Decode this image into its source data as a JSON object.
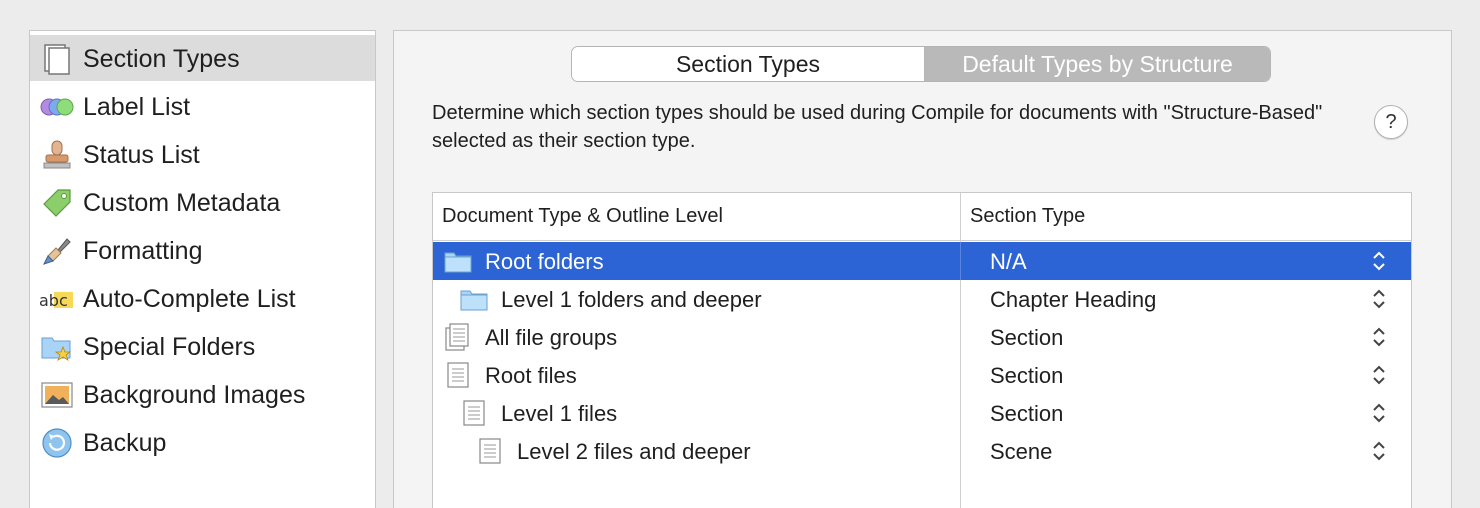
{
  "sidebar": {
    "items": [
      {
        "label": "Section Types",
        "icon": "pages-icon",
        "selected": true
      },
      {
        "label": "Label List",
        "icon": "label-circles-icon"
      },
      {
        "label": "Status List",
        "icon": "stamp-icon"
      },
      {
        "label": "Custom Metadata",
        "icon": "tag-icon"
      },
      {
        "label": "Formatting",
        "icon": "paintbrush-icon"
      },
      {
        "label": "Auto-Complete List",
        "icon": "abc-icon",
        "icon_text": "abc"
      },
      {
        "label": "Special Folders",
        "icon": "star-folder-icon"
      },
      {
        "label": "Background Images",
        "icon": "picture-icon"
      },
      {
        "label": "Backup",
        "icon": "backup-icon"
      }
    ]
  },
  "segmented": {
    "tab1": "Section Types",
    "tab2": "Default Types by Structure",
    "active": "tab2"
  },
  "description": "Determine which section types should be used during Compile for documents with \"Structure-Based\" selected as their section type.",
  "help_label": "?",
  "table": {
    "col1_header": "Document Type & Outline Level",
    "col2_header": "Section Type",
    "rows": [
      {
        "label": "Root folders",
        "type": "N/A",
        "icon": "folder-icon",
        "selected": true
      },
      {
        "label": "Level 1 folders and deeper",
        "type": "Chapter Heading",
        "icon": "folder-icon"
      },
      {
        "label": "All file groups",
        "type": "Section",
        "icon": "file-group-icon"
      },
      {
        "label": "Root files",
        "type": "Section",
        "icon": "file-icon"
      },
      {
        "label": "Level 1 files",
        "type": "Section",
        "icon": "file-icon"
      },
      {
        "label": "Level 2 files and deeper",
        "type": "Scene",
        "icon": "file-icon"
      }
    ]
  },
  "colors": {
    "selection": "#2c64d6",
    "folder": "#a9d3f7",
    "segment_active": "#b9b9b9"
  }
}
